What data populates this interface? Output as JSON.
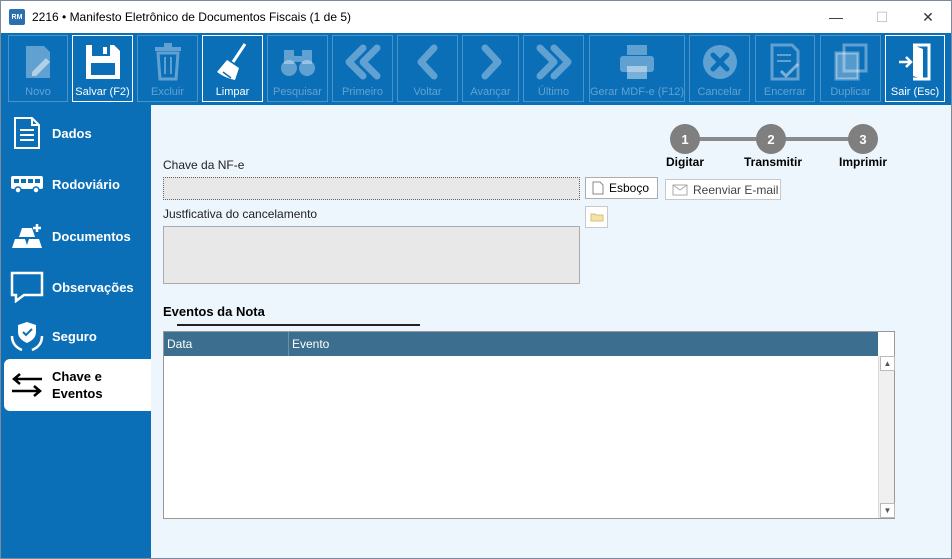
{
  "window": {
    "app_icon_text": "RM",
    "title": "2216 • Manifesto Eletrônico de Documentos Fiscais (1 de 5)",
    "controls": [
      "—",
      "☐",
      "✕"
    ]
  },
  "toolbar": {
    "buttons": [
      {
        "label": "Novo",
        "icon": "pencil-doc-icon",
        "enabled": false
      },
      {
        "label": "Salvar (F2)",
        "icon": "floppy-disk-icon",
        "enabled": true
      },
      {
        "label": "Excluir",
        "icon": "trash-icon",
        "enabled": false
      },
      {
        "label": "Limpar",
        "icon": "broom-icon",
        "enabled": true
      },
      {
        "label": "Pesquisar",
        "icon": "binoculars-icon",
        "enabled": false
      },
      {
        "label": "Primeiro",
        "icon": "double-chevron-left-icon",
        "enabled": false
      },
      {
        "label": "Voltar",
        "icon": "chevron-left-icon",
        "enabled": false
      },
      {
        "label": "Avançar",
        "icon": "chevron-right-icon",
        "enabled": false
      },
      {
        "label": "Último",
        "icon": "double-chevron-right-icon",
        "enabled": false
      },
      {
        "label": "Gerar MDF-e (F12)",
        "icon": "printer-icon",
        "enabled": false
      },
      {
        "label": "Cancelar",
        "icon": "cancel-circle-icon",
        "enabled": false
      },
      {
        "label": "Encerrar",
        "icon": "checked-doc-icon",
        "enabled": false
      },
      {
        "label": "Duplicar",
        "icon": "duplicate-icon",
        "enabled": false
      },
      {
        "label": "Sair (Esc)",
        "icon": "exit-door-icon",
        "enabled": true
      }
    ]
  },
  "sidebar": {
    "items": [
      {
        "label": "Dados",
        "icon": "document-icon"
      },
      {
        "label": "Rodoviário",
        "icon": "bus-icon"
      },
      {
        "label": "Documentos",
        "icon": "gold-bars-icon"
      },
      {
        "label": "Observações",
        "icon": "speech-bubble-icon"
      },
      {
        "label": "Seguro",
        "icon": "shield-hands-icon"
      },
      {
        "label_line1": "Chave e",
        "label_line2": "Eventos",
        "icon": "arrows-exchange-icon",
        "selected": true
      }
    ]
  },
  "steps": [
    {
      "number": "1",
      "label": "Digitar"
    },
    {
      "number": "2",
      "label": "Transmitir"
    },
    {
      "number": "3",
      "label": "Imprimir"
    }
  ],
  "form": {
    "chave_label": "Chave da NF-e",
    "chave_value": "",
    "esboco_label": "Esboço",
    "reenviar_label": "Reenviar E-mail",
    "justificativa_label": "Justficativa do cancelamento",
    "justificativa_value": ""
  },
  "events": {
    "title": "Eventos da Nota",
    "columns": [
      "Data",
      "Evento"
    ],
    "rows": []
  },
  "colors": {
    "primary": "#0b6fb8",
    "panel": "#eef6fd",
    "grid_header": "#3b6e8f",
    "step": "#7f7f7f"
  }
}
